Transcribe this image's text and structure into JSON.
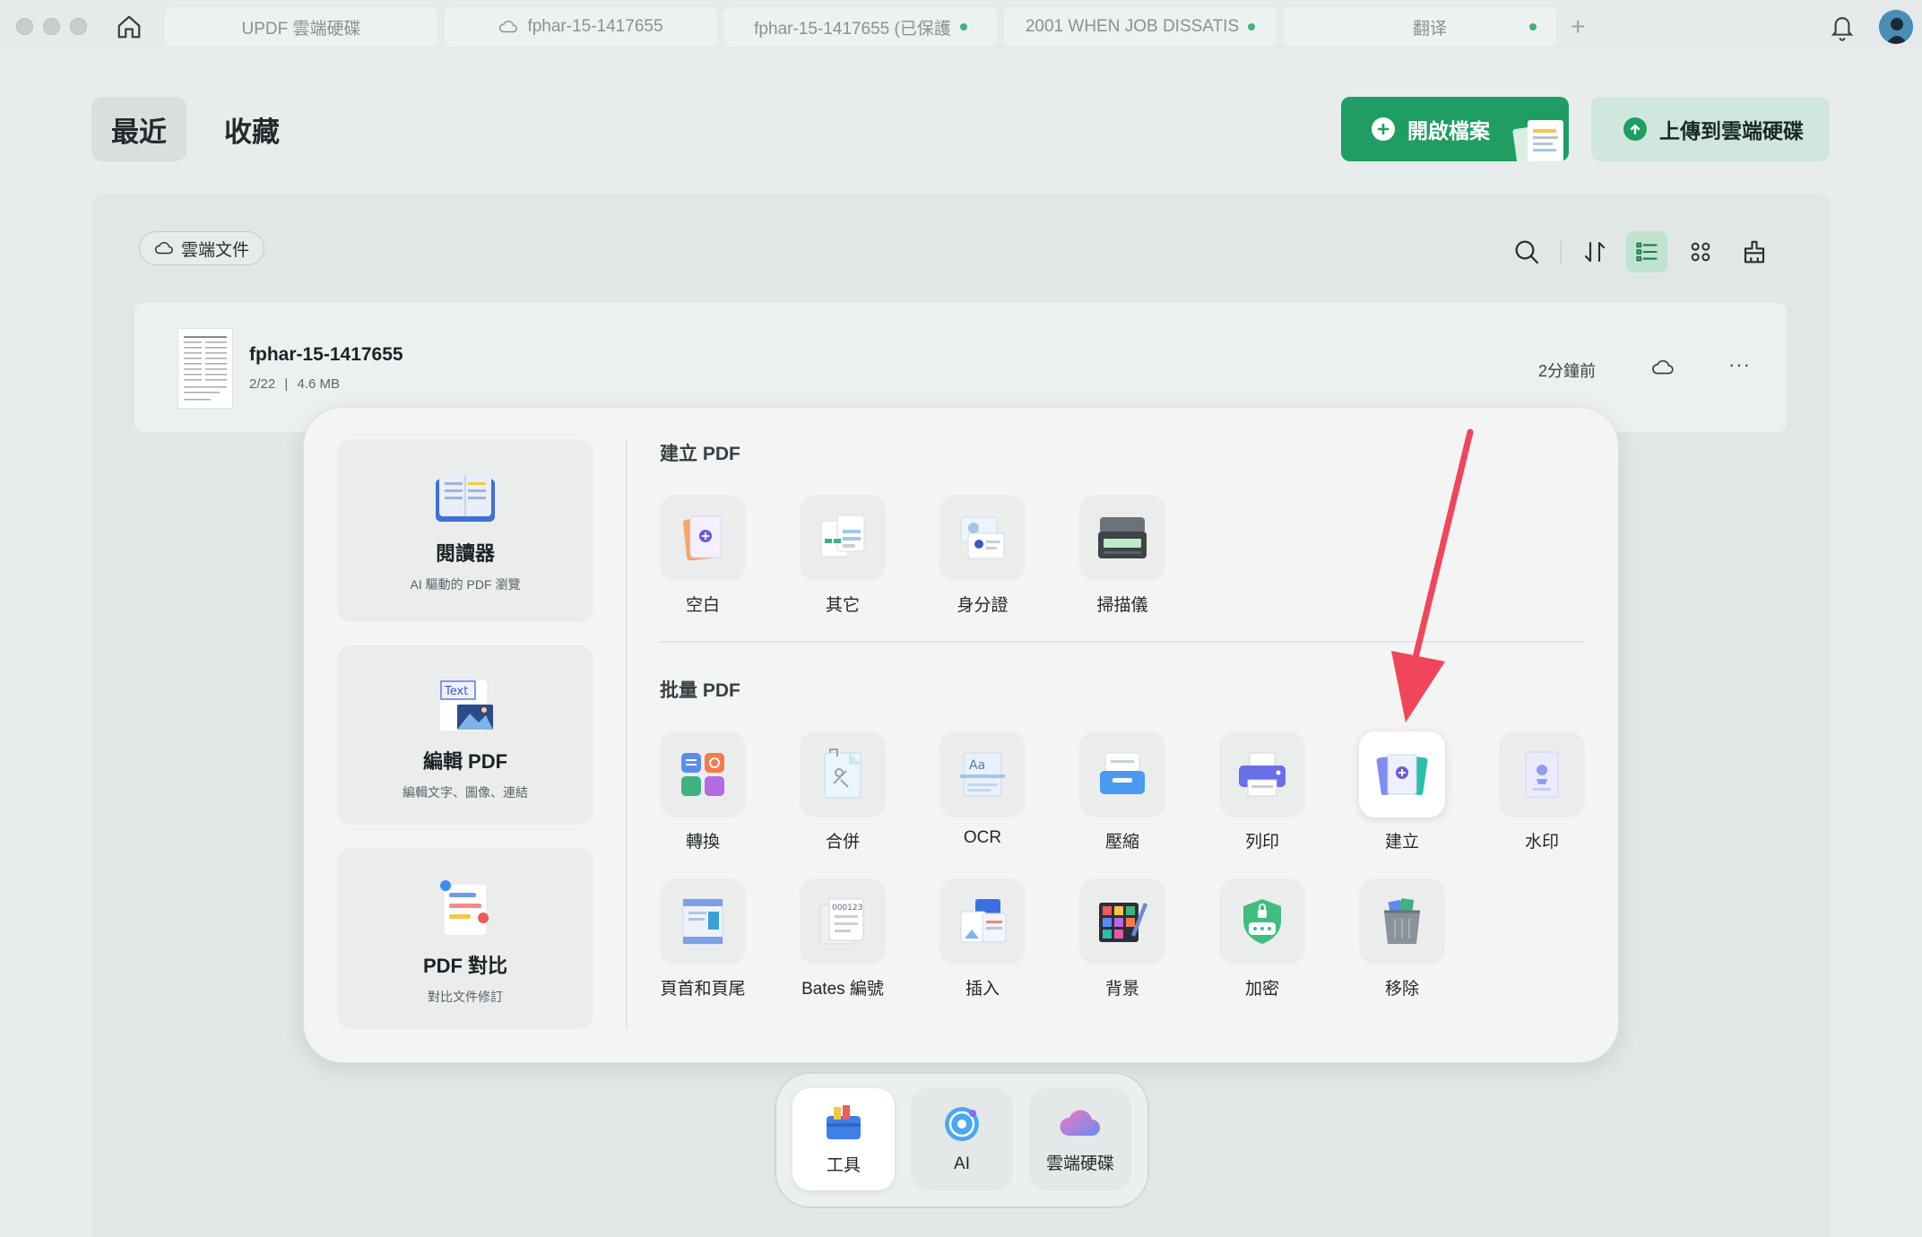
{
  "tabs": [
    {
      "label": "UPDF 雲端硬碟",
      "icon": "",
      "dot": false
    },
    {
      "label": "fphar-15-1417655",
      "icon": "cloud-icon",
      "dot": false
    },
    {
      "label": "fphar-15-1417655 (已保護",
      "icon": "",
      "dot": true
    },
    {
      "label": "2001 WHEN JOB DISSATIS",
      "icon": "",
      "dot": true
    },
    {
      "label": "翻译",
      "icon": "",
      "dot": true
    }
  ],
  "new_tab": "+",
  "header": {
    "tab_recent": "最近",
    "tab_favorites": "收藏",
    "open_file": "開啟檔案",
    "upload_cloud": "上傳到雲端硬碟"
  },
  "filter": {
    "cloud_docs": "雲端文件"
  },
  "file": {
    "name": "fphar-15-1417655",
    "pages": "2/22",
    "size": "4.6 MB",
    "time": "2分鐘前",
    "more": "···"
  },
  "side_cards": [
    {
      "title": "閱讀器",
      "sub": "AI 驅動的 PDF 瀏覽",
      "icon": "reader-icon"
    },
    {
      "title": "編輯 PDF",
      "sub": "編輯文字、圖像、連結",
      "icon": "edit-pdf-icon",
      "badge": "Text"
    },
    {
      "title": "PDF 對比",
      "sub": "對比文件修訂",
      "icon": "compare-icon"
    }
  ],
  "create_section": {
    "title": "建立 PDF",
    "items": [
      {
        "label": "空白",
        "icon": "blank-icon"
      },
      {
        "label": "其它",
        "icon": "other-icon"
      },
      {
        "label": "身分證",
        "icon": "id-card-icon"
      },
      {
        "label": "掃描儀",
        "icon": "scanner-icon"
      }
    ]
  },
  "batch_section": {
    "title": "批量 PDF",
    "items": [
      {
        "label": "轉換",
        "icon": "convert-icon"
      },
      {
        "label": "合併",
        "icon": "merge-icon"
      },
      {
        "label": "OCR",
        "icon": "ocr-icon",
        "glyph": "Aa"
      },
      {
        "label": "壓縮",
        "icon": "compress-icon"
      },
      {
        "label": "列印",
        "icon": "print-icon"
      },
      {
        "label": "建立",
        "icon": "create-icon"
      },
      {
        "label": "水印",
        "icon": "watermark-icon"
      },
      {
        "label": "頁首和頁尾",
        "icon": "header-footer-icon"
      },
      {
        "label": "Bates 編號",
        "icon": "bates-icon",
        "glyph": "000123"
      },
      {
        "label": "插入",
        "icon": "insert-icon"
      },
      {
        "label": "背景",
        "icon": "background-icon"
      },
      {
        "label": "加密",
        "icon": "encrypt-icon"
      },
      {
        "label": "移除",
        "icon": "remove-icon"
      }
    ]
  },
  "dock": [
    {
      "label": "工具",
      "icon": "tools-icon"
    },
    {
      "label": "AI",
      "icon": "ai-icon"
    },
    {
      "label": "雲端硬碟",
      "icon": "cloud-drive-icon"
    }
  ],
  "colors": {
    "accent": "#1f9d62",
    "accent_light": "#cfe7dc",
    "arrow": "#f0455a"
  }
}
